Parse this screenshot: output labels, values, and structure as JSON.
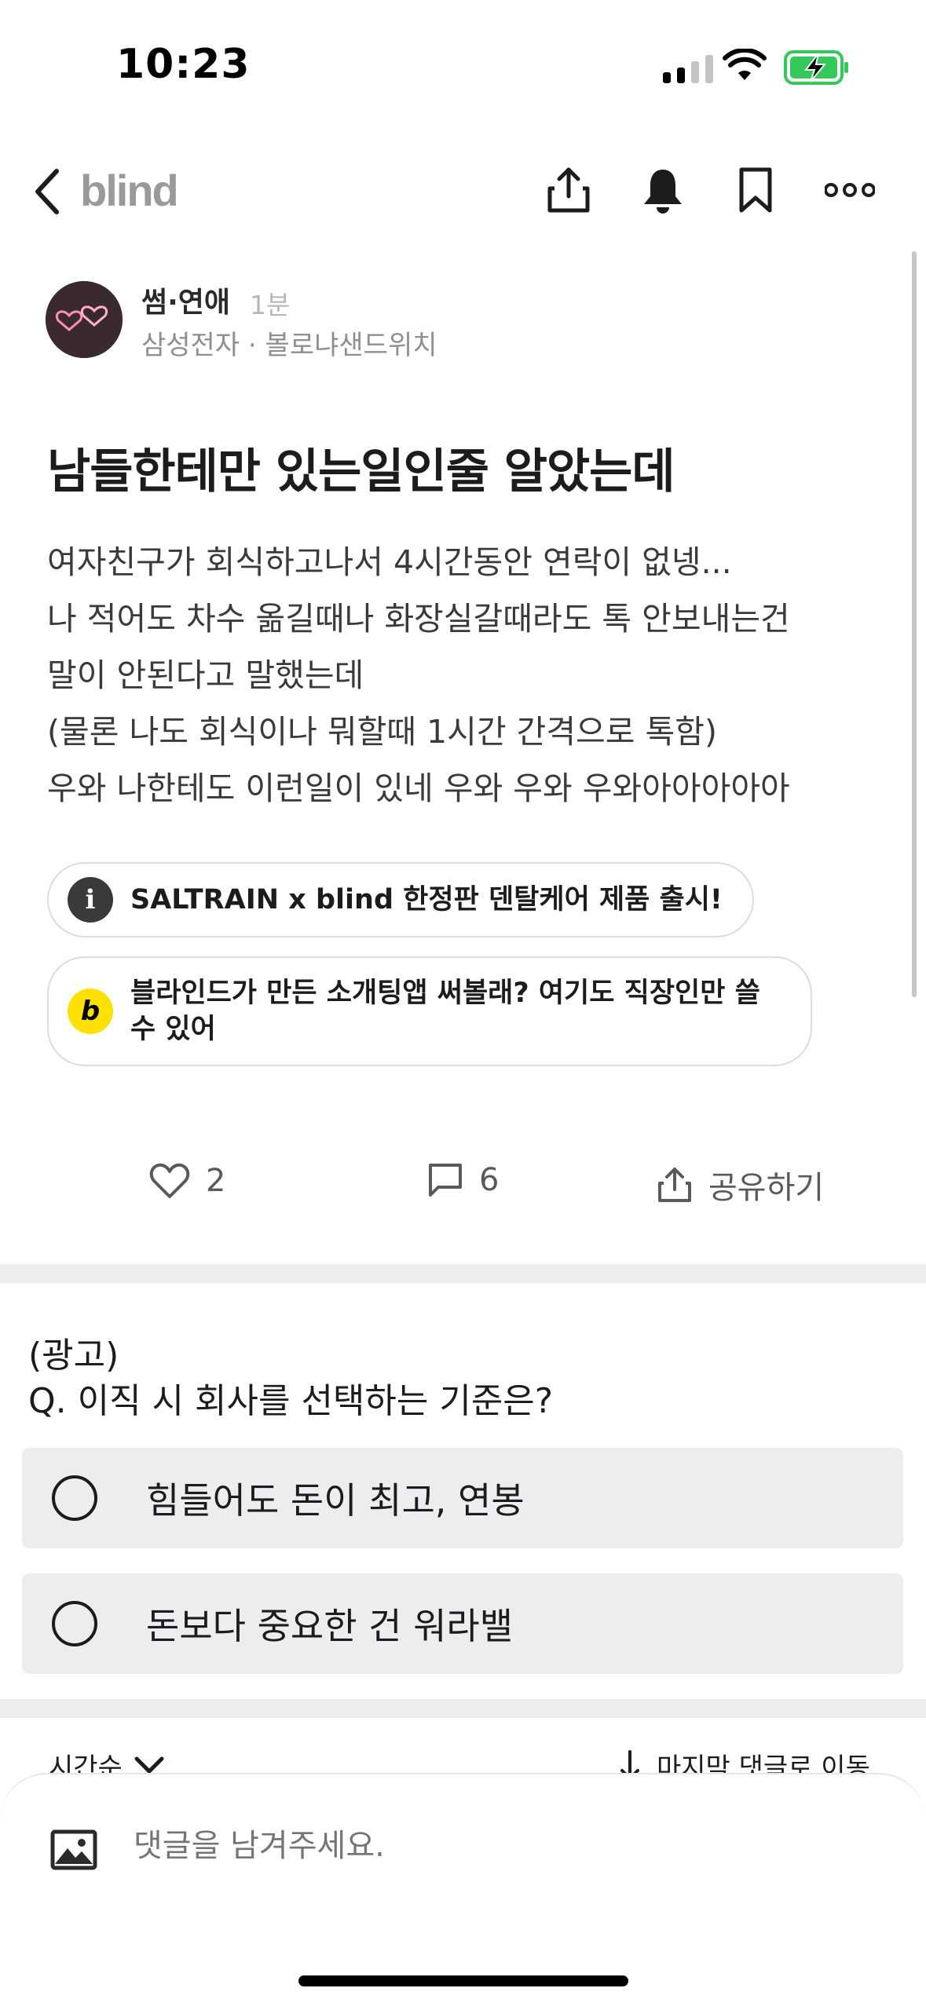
{
  "status_bar": {
    "time": "10:23"
  },
  "nav": {
    "logo": "blind"
  },
  "post": {
    "board": "썸·연애",
    "time_ago": "1분",
    "company": "삼성전자 · 볼로냐샌드위치",
    "title": "남들한테만 있는일인줄 알았는데",
    "body_lines": [
      "여자친구가 회식하고나서 4시간동안 연락이 없넹...",
      "나 적어도 차수 옮길때나 화장실갈때라도 톡 안보내는건",
      "말이 안된다고 말했는데",
      "(물론 나도 회식이나 뭐할때 1시간 간격으로 톡함)",
      "우와 나한테도 이런일이 있네 우와 우와 우와아아아아아"
    ]
  },
  "promos": [
    {
      "icon": "info-icon",
      "text": "SALTRAIN x blind 한정판 덴탈케어 제품 출시!"
    },
    {
      "icon": "blind-b-icon",
      "text_line1": "블라인드가 만든 소개팅앱 써볼래? 여기도 직장인만 쓸",
      "text_line2": "수 있어"
    }
  ],
  "actions": {
    "likes": "2",
    "comments": "6",
    "share": "공유하기"
  },
  "ad_poll": {
    "label": "(광고)",
    "question": "Q. 이직 시 회사를 선택하는 기준은?",
    "options": [
      "힘들어도 돈이 최고, 연봉",
      "돈보다 중요한 건 워라밸"
    ]
  },
  "comments": {
    "sort": "시간순",
    "jump": "마지막 댓글로 이동",
    "placeholder": "댓글을 남겨주세요."
  },
  "colors": {
    "battery": "#34c759",
    "promo_b": "#ffe000",
    "divider": "#ededf0"
  }
}
